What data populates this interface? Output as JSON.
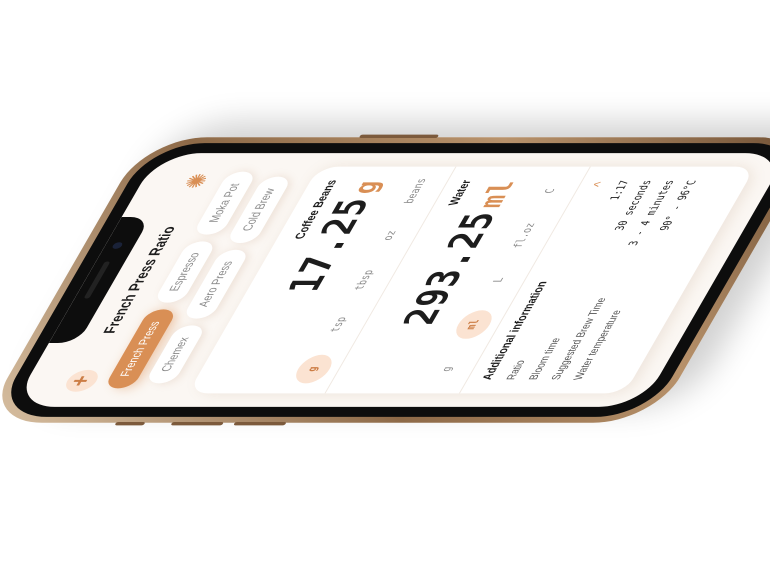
{
  "app": {
    "title": "French Press Ratio",
    "add_icon": "plus-icon",
    "settings_icon": "gear-icon"
  },
  "methods": [
    {
      "label": "French Press",
      "active": true
    },
    {
      "label": "Espresso",
      "active": false
    },
    {
      "label": "Moka Pot",
      "active": false
    },
    {
      "label": "Chemex",
      "active": false
    },
    {
      "label": "Aero Press",
      "active": false
    },
    {
      "label": "Cold Brew",
      "active": false
    }
  ],
  "coffee": {
    "label": "Coffee Beans",
    "value": "17.25",
    "unit": "g",
    "units": [
      "g",
      "tsp",
      "tbsp",
      "oz",
      "beans"
    ],
    "selected_unit": "g"
  },
  "water": {
    "label": "Water",
    "value": "293.25",
    "unit": "ml",
    "units": [
      "g",
      "ml",
      "L",
      "fl.oz",
      "C"
    ],
    "selected_unit": "ml"
  },
  "info": {
    "title": "Additional information",
    "rows": [
      {
        "label": "Ratio",
        "value": "1:17"
      },
      {
        "label": "Bloom time",
        "value": "30 seconds"
      },
      {
        "label": "Suggested Brew Time",
        "value": "3 - 4 minutes"
      },
      {
        "label": "Water temperature",
        "value": "90° - 96°C"
      }
    ],
    "collapse_icon": "chevron-up-icon"
  },
  "colors": {
    "accent": "#d98f55",
    "accent_soft": "#fbe3d2",
    "background": "#fbf7f3",
    "text": "#1d1d1d"
  }
}
